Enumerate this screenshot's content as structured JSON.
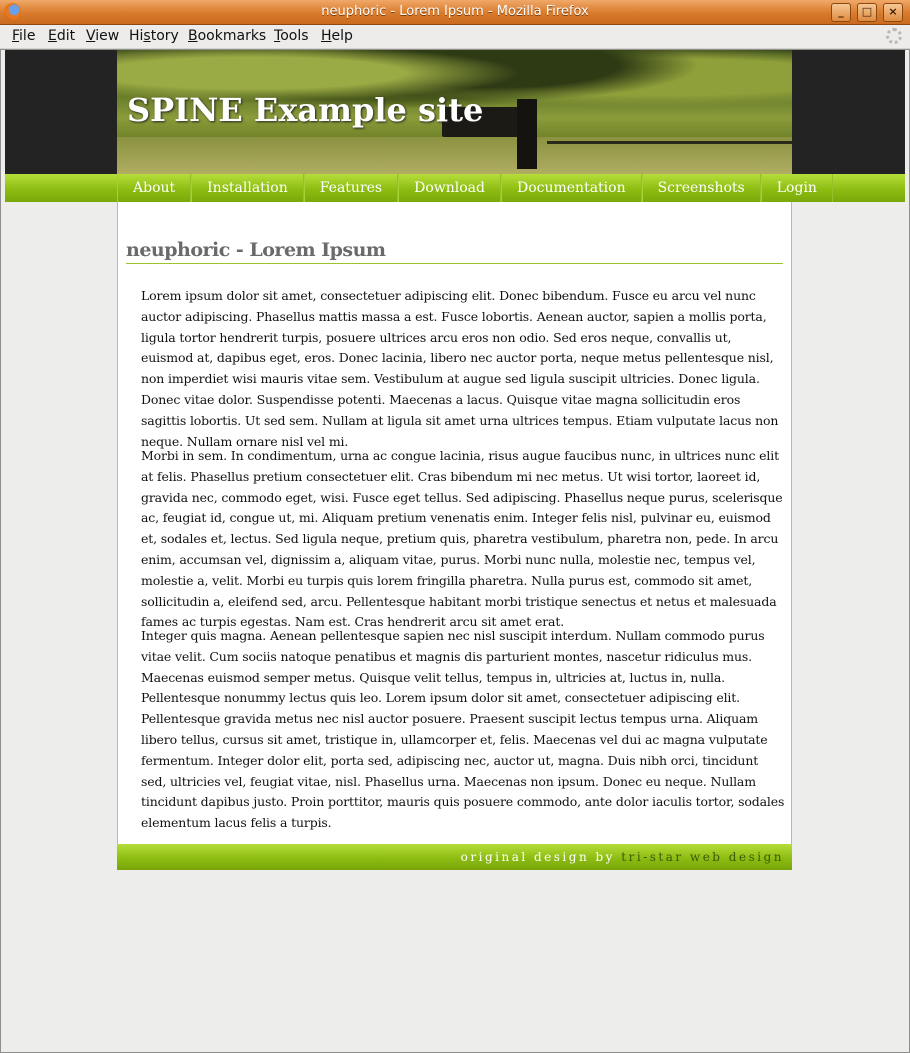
{
  "window": {
    "title": "neuphoric - Lorem Ipsum - Mozilla Firefox",
    "buttons": [
      "_",
      "□",
      "×"
    ]
  },
  "menubar": {
    "items": [
      "File",
      "Edit",
      "View",
      "History",
      "Bookmarks",
      "Tools",
      "Help"
    ],
    "accesskeys": [
      "F",
      "E",
      "V",
      "H",
      "B",
      "T",
      "H"
    ]
  },
  "header": {
    "site_title": "SPINE Example site"
  },
  "nav": {
    "items": [
      "About",
      "Installation",
      "Features",
      "Download",
      "Documentation",
      "Screenshots",
      "Login"
    ]
  },
  "content": {
    "heading": "neuphoric - Lorem Ipsum",
    "paragraphs": [
      "Lorem ipsum dolor sit amet, consectetuer adipiscing elit. Donec bibendum. Fusce eu arcu vel nunc auctor adipiscing. Phasellus mattis massa a est. Fusce lobortis. Aenean auctor, sapien a mollis porta, ligula tortor hendrerit turpis, posuere ultrices arcu eros non odio. Sed eros neque, convallis ut, euismod at, dapibus eget, eros. Donec lacinia, libero nec auctor porta, neque metus pellentesque nisl, non imperdiet wisi mauris vitae sem. Vestibulum at augue sed ligula suscipit ultricies. Donec ligula. Donec vitae dolor. Suspendisse potenti. Maecenas a lacus. Quisque vitae magna sollicitudin eros sagittis lobortis. Ut sed sem. Nullam at ligula sit amet urna ultrices tempus. Etiam vulputate lacus non neque. Nullam ornare nisl vel mi.",
      "Morbi in sem. In condimentum, urna ac congue lacinia, risus augue faucibus nunc, in ultrices nunc elit at felis. Phasellus pretium consectetuer elit. Cras bibendum mi nec metus. Ut wisi tortor, laoreet id, gravida nec, commodo eget, wisi. Fusce eget tellus. Sed adipiscing. Phasellus neque purus, scelerisque ac, feugiat id, congue ut, mi. Aliquam pretium venenatis enim. Integer felis nisl, pulvinar eu, euismod et, sodales et, lectus. Sed ligula neque, pretium quis, pharetra vestibulum, pharetra non, pede. In arcu enim, accumsan vel, dignissim a, aliquam vitae, purus. Morbi nunc nulla, molestie nec, tempus vel, molestie a, velit. Morbi eu turpis quis lorem fringilla pharetra. Nulla purus est, commodo sit amet, sollicitudin a, eleifend sed, arcu. Pellentesque habitant morbi tristique senectus et netus et malesuada fames ac turpis egestas. Nam est. Cras hendrerit arcu sit amet erat.",
      "Integer quis magna. Aenean pellentesque sapien nec nisl suscipit interdum. Nullam commodo purus vitae velit. Cum sociis natoque penatibus et magnis dis parturient montes, nascetur ridiculus mus. Maecenas euismod semper metus. Quisque velit tellus, tempus in, ultricies at, luctus in, nulla. Pellentesque nonummy lectus quis leo. Lorem ipsum dolor sit amet, consectetuer adipiscing elit. Pellentesque gravida metus nec nisl auctor posuere. Praesent suscipit lectus tempus urna. Aliquam libero tellus, cursus sit amet, tristique in, ullamcorper et, felis. Maecenas vel dui ac magna vulputate fermentum. Integer dolor elit, porta sed, adipiscing nec, auctor ut, magna. Duis nibh orci, tincidunt sed, ultricies vel, feugiat vitae, nisl. Phasellus urna. Maecenas non ipsum. Donec eu neque. Nullam tincidunt dapibus justo. Proin porttitor, mauris quis posuere commodo, ante dolor iaculis tortor, sodales elementum lacus felis a turpis."
    ]
  },
  "footer": {
    "prefix": "original design by",
    "link": "tri-star web design"
  },
  "colors": {
    "accent_green": "#8dbd12",
    "titlebar_orange": "#d87a2c",
    "heading_gray": "#6a6a6a"
  }
}
